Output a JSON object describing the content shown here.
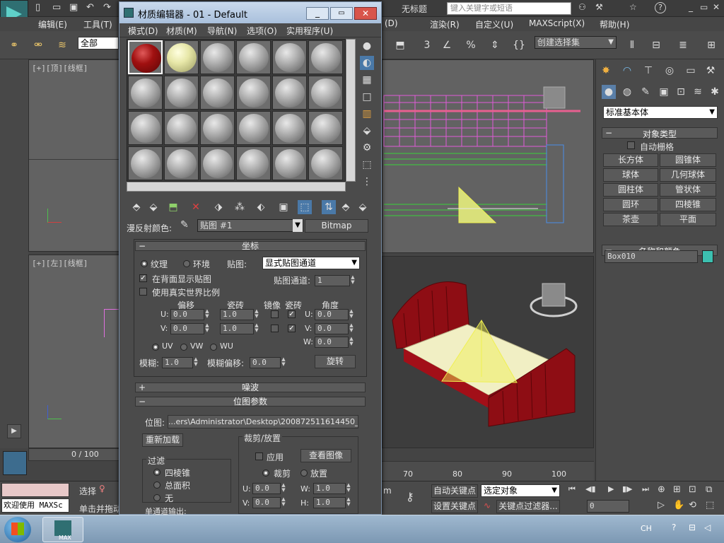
{
  "app": {
    "title": "无标题",
    "search_placeholder": "键入关键字或短语",
    "help_label": "?",
    "menu": [
      "编辑(E)",
      "工具(T)",
      "(D)",
      "渲染(R)",
      "自定义(U)",
      "MAXScript(X)",
      "帮助(H)"
    ],
    "selection_filter": "全部",
    "named_selection": "创建选择集"
  },
  "viewports": {
    "top_label": "[+][顶][线框]",
    "left_label": "[+][左][线框]",
    "persp_ruler": [
      "70",
      "80",
      "90",
      "100"
    ]
  },
  "command_panel": {
    "dropdown": "标准基本体",
    "object_type_title": "对象类型",
    "auto_grid": "自动栅格",
    "buttons": [
      "长方体",
      "圆锥体",
      "球体",
      "几何球体",
      "圆柱体",
      "管状体",
      "圆环",
      "四棱锥",
      "茶壶",
      "平面"
    ],
    "name_color_title": "名称和颜色",
    "object_name": "Box010",
    "object_color": "#3cc0b0"
  },
  "material_editor": {
    "title": "材质编辑器 - 01 - Default",
    "menu": [
      "模式(D)",
      "材质(M)",
      "导航(N)",
      "选项(O)",
      "实用程序(U)"
    ],
    "diffuse_label": "漫反射颜色:",
    "map_name": "贴图 #1",
    "map_type": "Bitmap",
    "coordinates": {
      "title": "坐标",
      "texture": "纹理",
      "environ": "环境",
      "mapping_label": "贴图:",
      "mapping_value": "显式贴图通道",
      "show_back": "在背面显示贴图",
      "map_channel_label": "贴图通道:",
      "map_channel_value": "1",
      "real_world": "使用真实世界比例",
      "col_offset": "偏移",
      "col_tiling": "瓷砖",
      "col_mirror": "镜像",
      "col_tile": "瓷砖",
      "col_angle": "角度",
      "u_label": "U:",
      "v_label": "V:",
      "w_label": "W:",
      "u_offset": "0.0",
      "v_offset": "0.0",
      "u_tiling": "1.0",
      "v_tiling": "1.0",
      "u_angle": "0.0",
      "v_angle": "0.0",
      "w_angle": "0.0",
      "uv": "UV",
      "vw": "VW",
      "wu": "WU",
      "blur_label": "模糊:",
      "blur_value": "1.0",
      "blur_offset_label": "模糊偏移:",
      "blur_offset_value": "0.0",
      "rotate_button": "旋转"
    },
    "noise_title": "噪波",
    "bitmap_params": {
      "title": "位图参数",
      "bitmap_label": "位图:",
      "bitmap_path": "...ers\\Administrator\\Desktop\\200872511614450_2.jpg",
      "reload": "重新加载",
      "crop_title": "裁剪/放置",
      "apply": "应用",
      "view_image": "查看图像",
      "crop": "裁剪",
      "place": "放置",
      "filter_title": "过滤",
      "pyramidal": "四棱锥",
      "summed_area": "总面积",
      "none": "无",
      "u_label": "U:",
      "v_label": "V:",
      "w_label": "W:",
      "h_label": "H:",
      "u_value": "0.0",
      "v_value": "0.0",
      "w_value": "1.0",
      "h_value": "1.0",
      "mono_output": "单通道输出:"
    }
  },
  "status": {
    "frame": "0 / 100",
    "welcome": "欢迎使用 MAXSc",
    "select_label": "选择",
    "prompt": "单击并拖动",
    "auto_key": "自动关键点",
    "set_key": "设置关键点",
    "selected_object": "选定对象",
    "key_filter": "关键点过滤器...",
    "frame_field": "0",
    "m_label": "m"
  },
  "taskbar": {
    "lang": "CH",
    "max_label": "MAX"
  }
}
